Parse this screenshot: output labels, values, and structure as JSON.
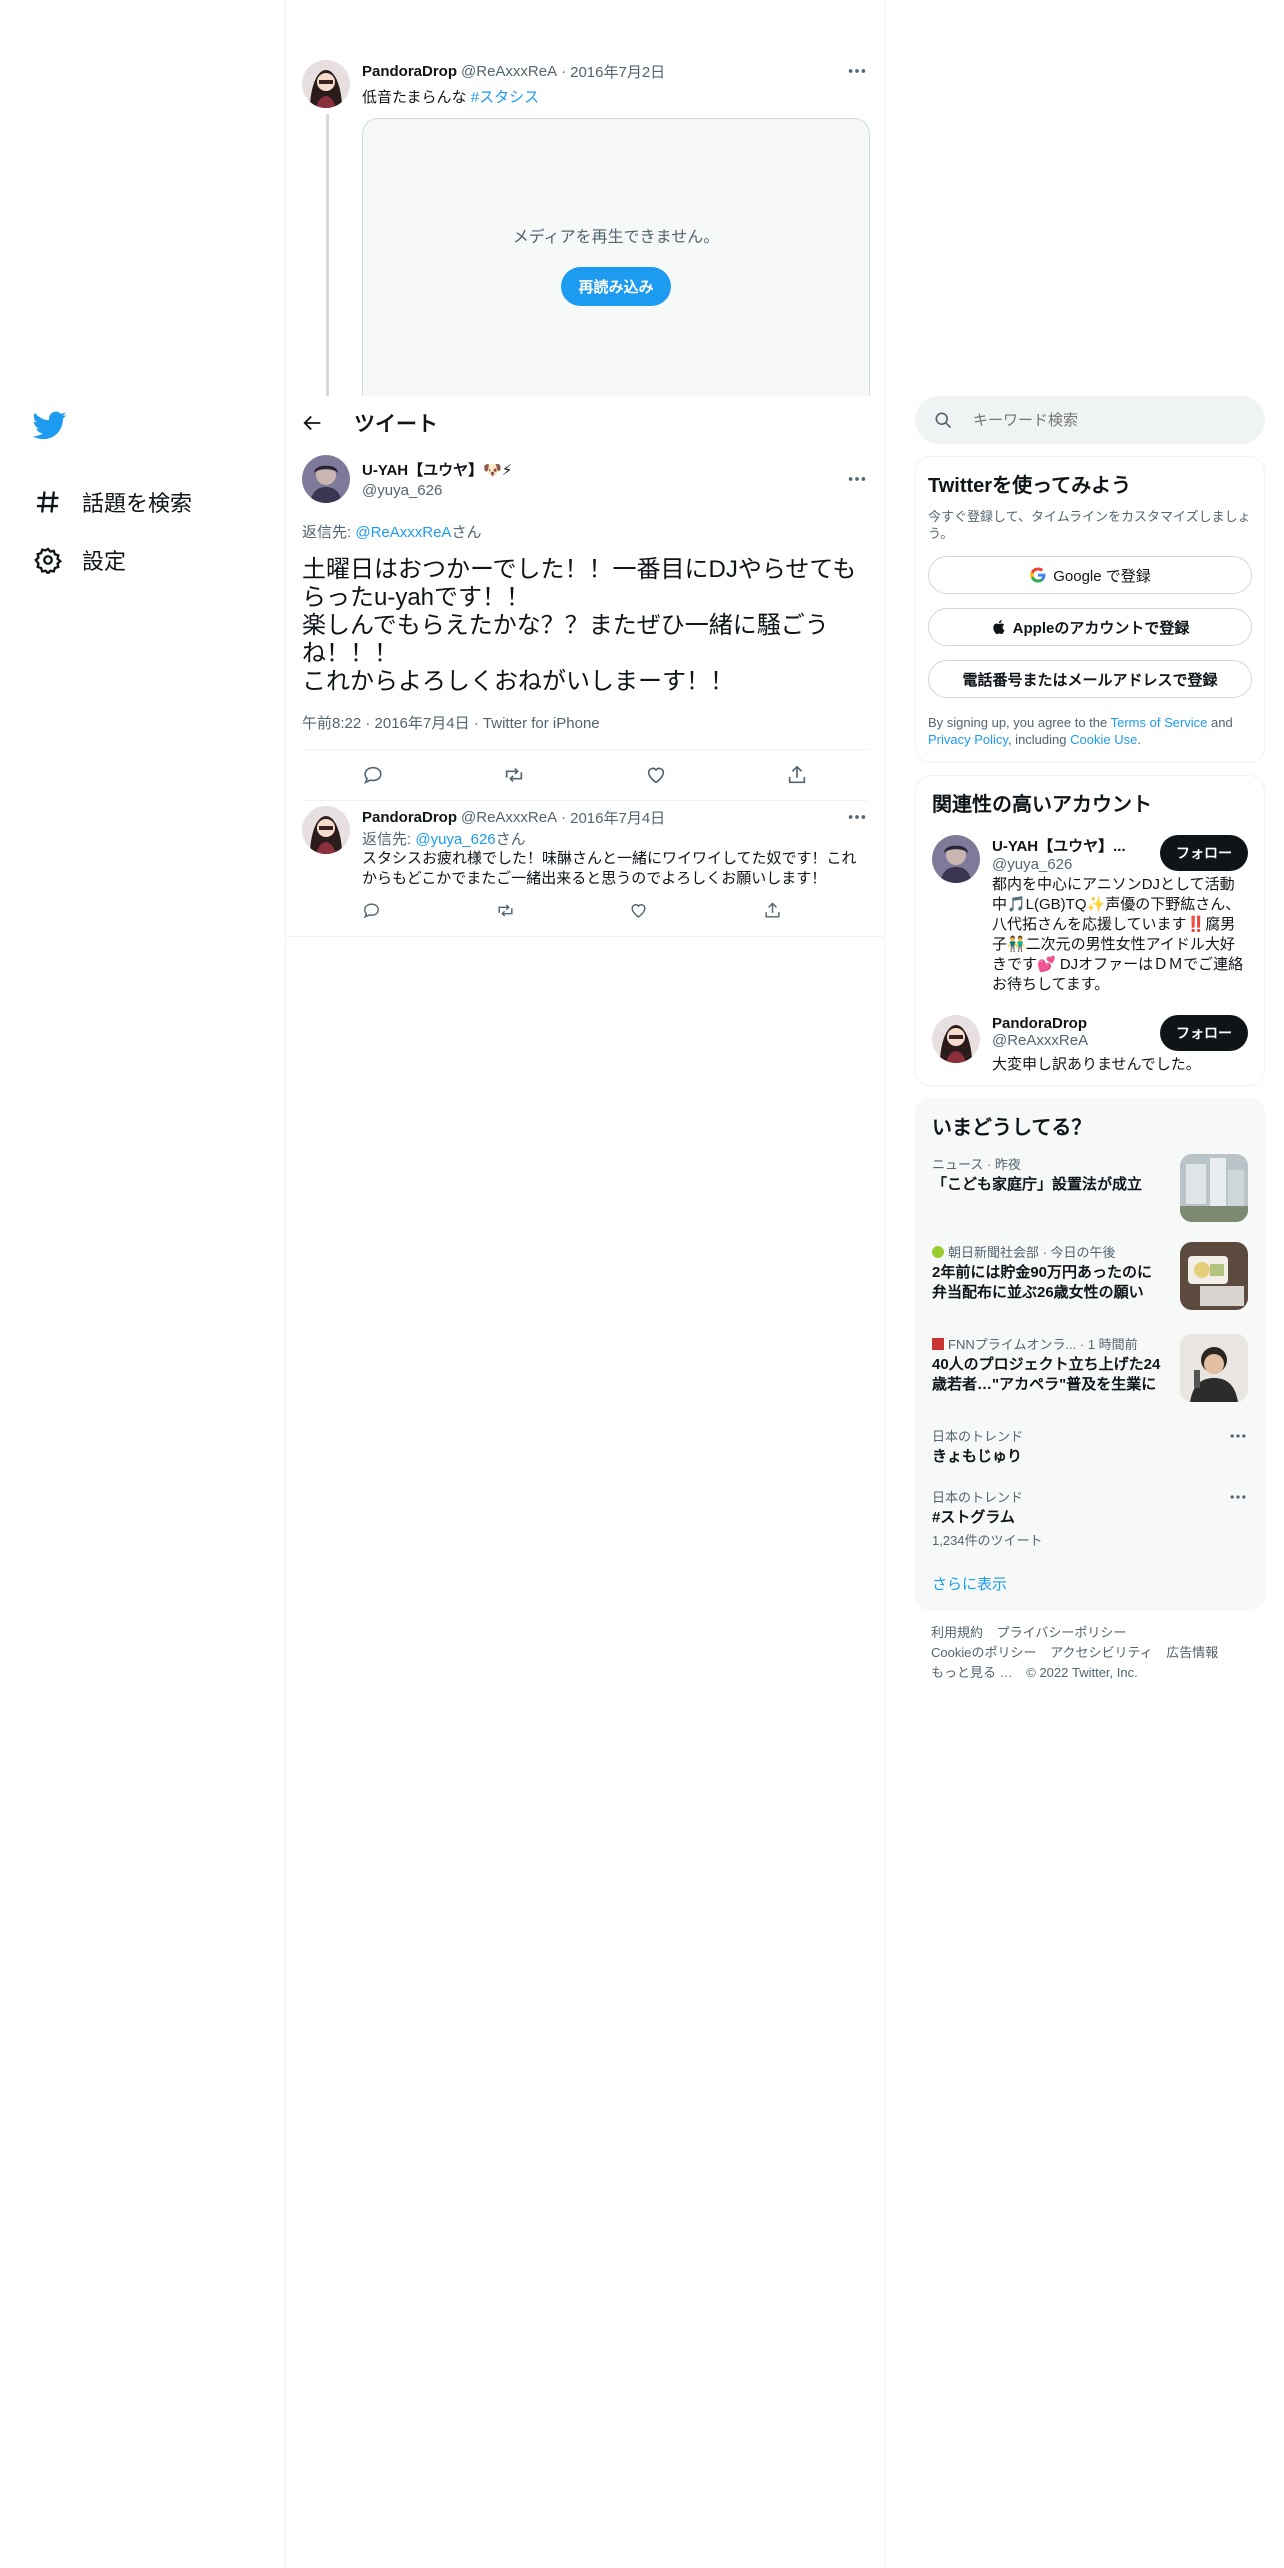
{
  "colors": {
    "accent": "#1d9bf0",
    "text": "#0f1419",
    "muted": "#536471",
    "border": "#eff3f4"
  },
  "nav": {
    "logo_icon": "twitter-bird-icon",
    "items": [
      {
        "label": "話題を検索",
        "icon": "hashtag-icon"
      },
      {
        "label": "設定",
        "icon": "gear-icon"
      }
    ]
  },
  "header": {
    "title": "ツイート"
  },
  "previous_tweet": {
    "name": "PandoraDrop",
    "handle": "@ReAxxxReA",
    "dot": "·",
    "date": "2016年7月2日",
    "text": "低音たまらんな",
    "hashtag": "#スタシス",
    "media_message": "メディアを再生できません。",
    "reload_label": "再読み込み"
  },
  "focused_tweet": {
    "name": "U-YAH【ユウヤ】🐶⚡",
    "handle": "@yuya_626",
    "reply_prefix": "返信先: ",
    "reply_to": "@ReAxxxReA",
    "reply_suffix": "さん",
    "text": "土曜日はおつかーでした！！一番目にDJやらせてもらったu-yahです！！\n楽しんでもらえたかな？？またぜひ一緒に騒ごうね！！！\nこれからよろしくおねがいしまーす！！",
    "meta": "午前8:22 · 2016年7月4日 · Twitter for iPhone"
  },
  "reply_tweet": {
    "name": "PandoraDrop",
    "handle": "@ReAxxxReA",
    "dot": "·",
    "date": "2016年7月4日",
    "reply_prefix": "返信先: ",
    "reply_to": "@yuya_626",
    "reply_suffix": "さん",
    "text": "スタシスお疲れ様でした！味醂さんと一緒にワイワイしてた奴です！これからもどこかでまたご一緒出来ると思うのでよろしくお願いします！"
  },
  "search": {
    "placeholder": "キーワード検索"
  },
  "signup": {
    "title": "Twitterを使ってみよう",
    "subtitle": "今すぐ登録して、タイムラインをカスタマイズしましょう。",
    "google_label": "Google で登録",
    "apple_label": "Appleのアカウントで登録",
    "phone_label": "電話番号またはメールアドレスで登録",
    "terms_prefix": "By signing up, you agree to the ",
    "terms_link": "Terms of Service",
    "terms_and": " and ",
    "privacy_link": "Privacy Policy",
    "including": ", including ",
    "cookie_link": "Cookie Use",
    "period": "."
  },
  "relevant": {
    "title": "関連性の高いアカウント",
    "follow_label": "フォロー",
    "accounts": [
      {
        "name": "U-YAH【ユウヤ】...",
        "handle": "@yuya_626",
        "bio": "都内を中心にアニソンDJとして活動中🎵L(GB)TQ✨声優の下野紘さん、八代拓さんを応援しています‼️腐男子👬二次元の男性女性アイドル大好きです💕 DJオファーはＤＭでご連絡お待ちしてます。"
      },
      {
        "name": "PandoraDrop",
        "handle": "@ReAxxxReA",
        "bio": "大変申し訳ありませんでした。"
      }
    ]
  },
  "trends": {
    "title": "いまどうしてる？",
    "items": [
      {
        "label": "ニュース · 昨夜",
        "title": "「こども家庭庁」設置法が成立"
      },
      {
        "label": "朝日新聞社会部 · 今日の午後",
        "title": "2年前には貯金90万円あったのに 弁当配布に並ぶ26歳女性の願い"
      },
      {
        "label": "FNNプライムオンラ... · 1 時間前",
        "title": "40人のプロジェクト立ち上げた24歳若者…\"アカペラ\"普及を生業に"
      },
      {
        "label": "日本のトレンド",
        "title": "きょもじゅり"
      },
      {
        "label": "日本のトレンド",
        "title": "#ストグラム",
        "count": "1,234件のツイート"
      }
    ],
    "show_more": "さらに表示"
  },
  "footer": {
    "links": [
      "利用規約",
      "プライバシーポリシー",
      "Cookieのポリシー",
      "アクセシビリティ",
      "広告情報",
      "もっと見る …"
    ],
    "copyright": "© 2022 Twitter, Inc."
  }
}
